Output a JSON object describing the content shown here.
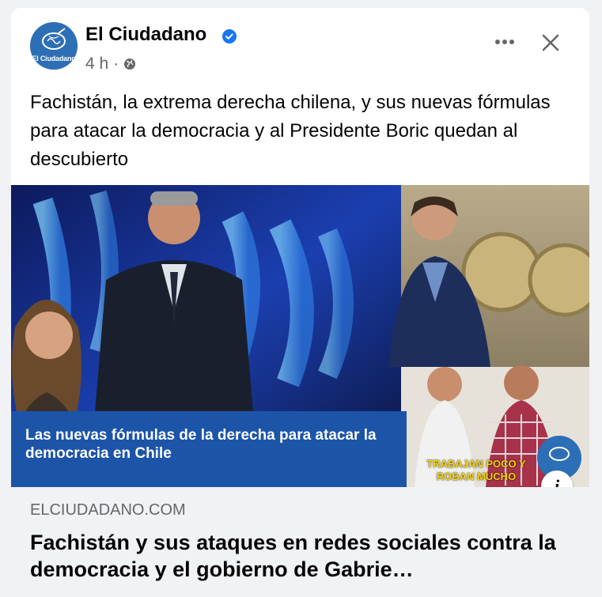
{
  "post": {
    "page_name": "El Ciudadano",
    "avatar_text": "El Ciudadano",
    "time": "4 h",
    "separator": "·",
    "privacy_icon": "globe-icon",
    "verified_icon": "verified-badge-icon",
    "more_icon": "more-options-icon",
    "close_icon": "close-icon",
    "text": "Fachistán, la extrema derecha chilena, y sus nuevas fórmulas para atacar la democracia y al Presidente Boric quedan al descubierto"
  },
  "image": {
    "headline": "Las nuevas fórmulas de la derecha para atacar la democracia en  Chile",
    "caption": "TRABAJAN POCO Y ROBAN MUCHO",
    "info_icon": "info-icon",
    "info_label": "i"
  },
  "link_preview": {
    "domain": "ELCIUDADANO.COM",
    "title": "Fachistán y sus ataques en redes sociales contra la democracia y el gobierno de Gabrie…"
  },
  "colors": {
    "brand_blue": "#1877f2",
    "headline_band": "#1c54a8",
    "caption_yellow": "#f5d20a",
    "preview_bg": "#f0f2f5"
  }
}
